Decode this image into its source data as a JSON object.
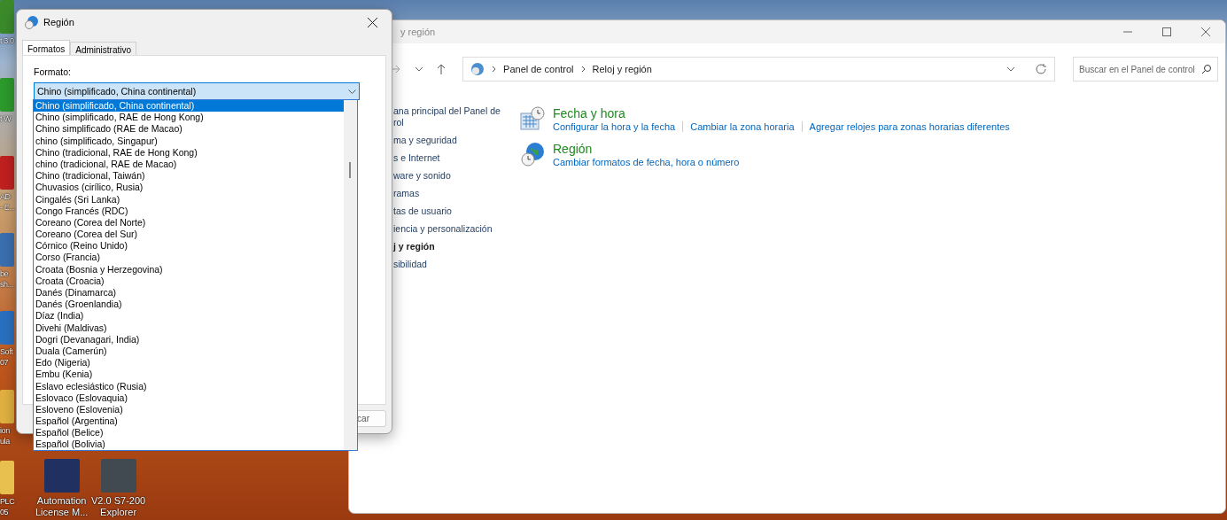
{
  "desktop_icons": [
    {
      "lines": [
        "t 3.0"
      ]
    },
    {
      "lines": [
        "t W"
      ]
    },
    {
      "lines": [
        "AD",
        "- E..."
      ]
    },
    {
      "lines": [
        "be",
        "sh..."
      ]
    },
    {
      "lines": [
        "Soft",
        "07"
      ]
    },
    {
      "lines": [
        "ion",
        "ula"
      ]
    },
    {
      "lines": [
        "PLC",
        "05"
      ]
    },
    {
      "lines": [
        "Automation",
        "License M..."
      ]
    },
    {
      "lines": [
        "V2.0 S7-200",
        "Explorer"
      ]
    }
  ],
  "control_panel": {
    "title": "y región",
    "breadcrumb": [
      "Panel de control",
      "Reloj y región"
    ],
    "search": {
      "placeholder": "Buscar en el Panel de control"
    },
    "sidebar": [
      {
        "lines": [
          "ana principal del Panel de",
          "rol"
        ],
        "selected": false
      },
      {
        "lines": [
          "ma y seguridad"
        ],
        "selected": false
      },
      {
        "lines": [
          "s e Internet"
        ],
        "selected": false
      },
      {
        "lines": [
          "ware y sonido"
        ],
        "selected": false
      },
      {
        "lines": [
          "ramas"
        ],
        "selected": false
      },
      {
        "lines": [
          "tas de usuario"
        ],
        "selected": false
      },
      {
        "lines": [
          "iencia y personalización"
        ],
        "selected": false
      },
      {
        "lines": [
          "j y región"
        ],
        "selected": true
      },
      {
        "lines": [
          "sibilidad"
        ],
        "selected": false
      }
    ],
    "sections": [
      {
        "kind": "clock",
        "title": "Fecha y hora",
        "links": [
          "Configurar la hora y la fecha",
          "Cambiar la zona horaria",
          "Agregar relojes para zonas horarias diferentes"
        ]
      },
      {
        "kind": "globe",
        "title": "Región",
        "links": [
          "Cambiar formatos de fecha, hora o número"
        ]
      }
    ]
  },
  "dialog": {
    "title": "Región",
    "tabs": [
      {
        "label": "Formatos",
        "selected": true
      },
      {
        "label": "Administrativo",
        "selected": false
      }
    ],
    "format_label": "Formato:",
    "format_value": "Chino (simplificado, China continental)",
    "button": "car",
    "options": [
      {
        "label": "Chino (simplificado, China continental)",
        "selected": true
      },
      {
        "label": "Chino (simplificado, RAE de Hong Kong)",
        "selected": false
      },
      {
        "label": "Chino simplificado (RAE de Macao)",
        "selected": false
      },
      {
        "label": "chino (simplificado, Singapur)",
        "selected": false
      },
      {
        "label": "Chino (tradicional, RAE de Hong Kong)",
        "selected": false
      },
      {
        "label": "chino (tradicional, RAE de Macao)",
        "selected": false
      },
      {
        "label": "Chino (tradicional, Taiwán)",
        "selected": false
      },
      {
        "label": "Chuvasios (cirílico, Rusia)",
        "selected": false
      },
      {
        "label": "Cingalés (Sri Lanka)",
        "selected": false
      },
      {
        "label": "Congo Francés (RDC)",
        "selected": false
      },
      {
        "label": "Coreano (Corea del Norte)",
        "selected": false
      },
      {
        "label": "Coreano (Corea del Sur)",
        "selected": false
      },
      {
        "label": "Córnico (Reino Unido)",
        "selected": false
      },
      {
        "label": "Corso (Francia)",
        "selected": false
      },
      {
        "label": "Croata (Bosnia y Herzegovina)",
        "selected": false
      },
      {
        "label": "Croata (Croacia)",
        "selected": false
      },
      {
        "label": "Danés (Dinamarca)",
        "selected": false
      },
      {
        "label": "Danés (Groenlandia)",
        "selected": false
      },
      {
        "label": "Díaz (India)",
        "selected": false
      },
      {
        "label": "Divehi (Maldivas)",
        "selected": false
      },
      {
        "label": "Dogri (Devanagari, India)",
        "selected": false
      },
      {
        "label": "Duala (Camerún)",
        "selected": false
      },
      {
        "label": "Edo (Nigeria)",
        "selected": false
      },
      {
        "label": "Embu (Kenia)",
        "selected": false
      },
      {
        "label": "Eslavo eclesiástico (Rusia)",
        "selected": false
      },
      {
        "label": "Eslovaco (Eslovaquia)",
        "selected": false
      },
      {
        "label": "Esloveno (Eslovenia)",
        "selected": false
      },
      {
        "label": "Español (Argentina)",
        "selected": false
      },
      {
        "label": "Español (Belice)",
        "selected": false
      },
      {
        "label": "Español (Bolivia)",
        "selected": false
      }
    ]
  }
}
